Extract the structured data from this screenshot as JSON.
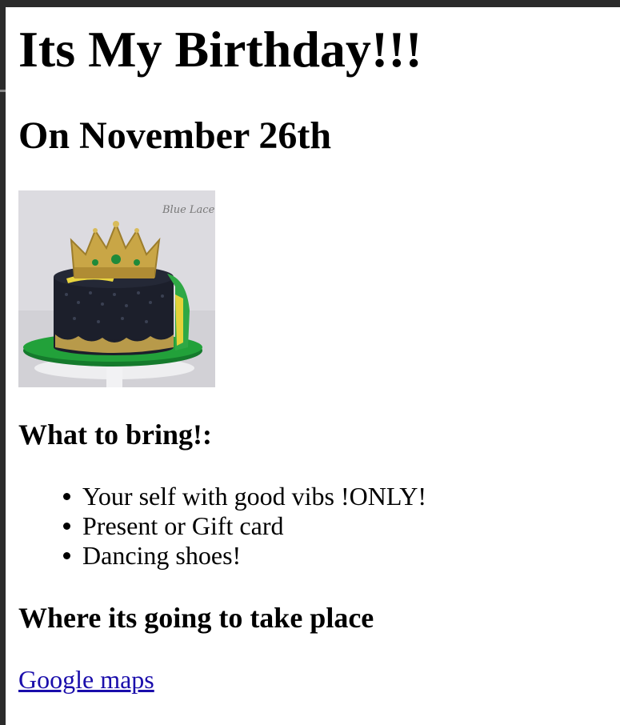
{
  "page": {
    "title": "Its My Birthday!!!",
    "subtitle": "On November 26th"
  },
  "image": {
    "subject": "birthday cake with gold crown",
    "watermark": "Blue Lace"
  },
  "bring": {
    "heading": "What to bring!:",
    "items": [
      "Your self with good vibs !ONLY!",
      "Present or Gift card",
      "Dancing shoes!"
    ]
  },
  "location": {
    "heading": "Where its going to take place",
    "link_text": "Google maps"
  },
  "colors": {
    "link": "#1a0dab",
    "chrome": "#2b2b2b"
  }
}
